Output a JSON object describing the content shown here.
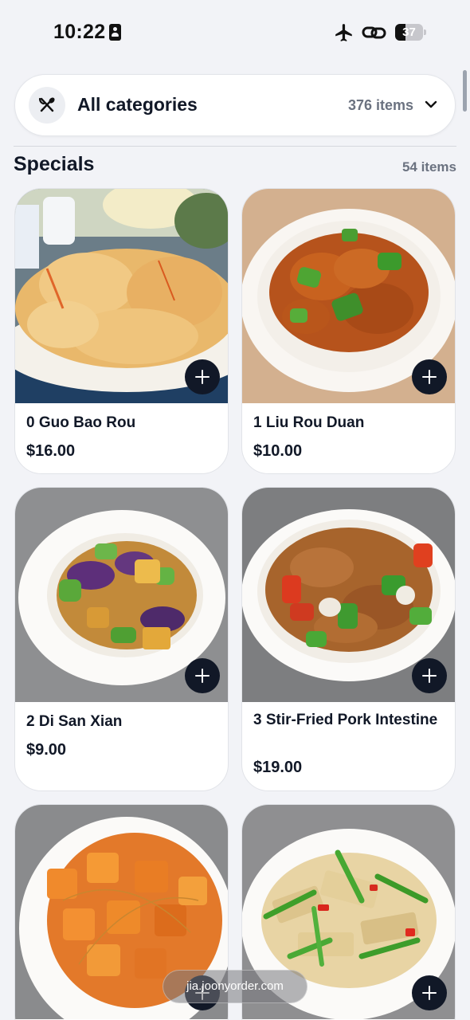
{
  "status_bar": {
    "time": "10:22",
    "battery": "37",
    "battery_level": 0.37,
    "icons": [
      "id-card-icon",
      "airplane-icon",
      "link-icon",
      "battery-icon"
    ]
  },
  "category_selector": {
    "icon": "utensils-icon",
    "label": "All categories",
    "count": "376 items",
    "chevron": "chevron-down-icon"
  },
  "section": {
    "title": "Specials",
    "count": "54 items"
  },
  "products": [
    {
      "name": "0 Guo Bao Rou",
      "price": "$16.00"
    },
    {
      "name": "1 Liu Rou Duan",
      "price": "$10.00"
    },
    {
      "name": "2 Di San Xian",
      "price": "$9.00"
    },
    {
      "name": "3 Stir-Fried Pork Intestine",
      "price": "$19.00"
    },
    {
      "name": "",
      "price": ""
    },
    {
      "name": "",
      "price": ""
    }
  ],
  "footer": {
    "url": "jia.joonyorder.com"
  },
  "colors": {
    "background": "#f2f3f7",
    "text": "#111827",
    "muted": "#6b7280",
    "add_button": "#111827"
  }
}
